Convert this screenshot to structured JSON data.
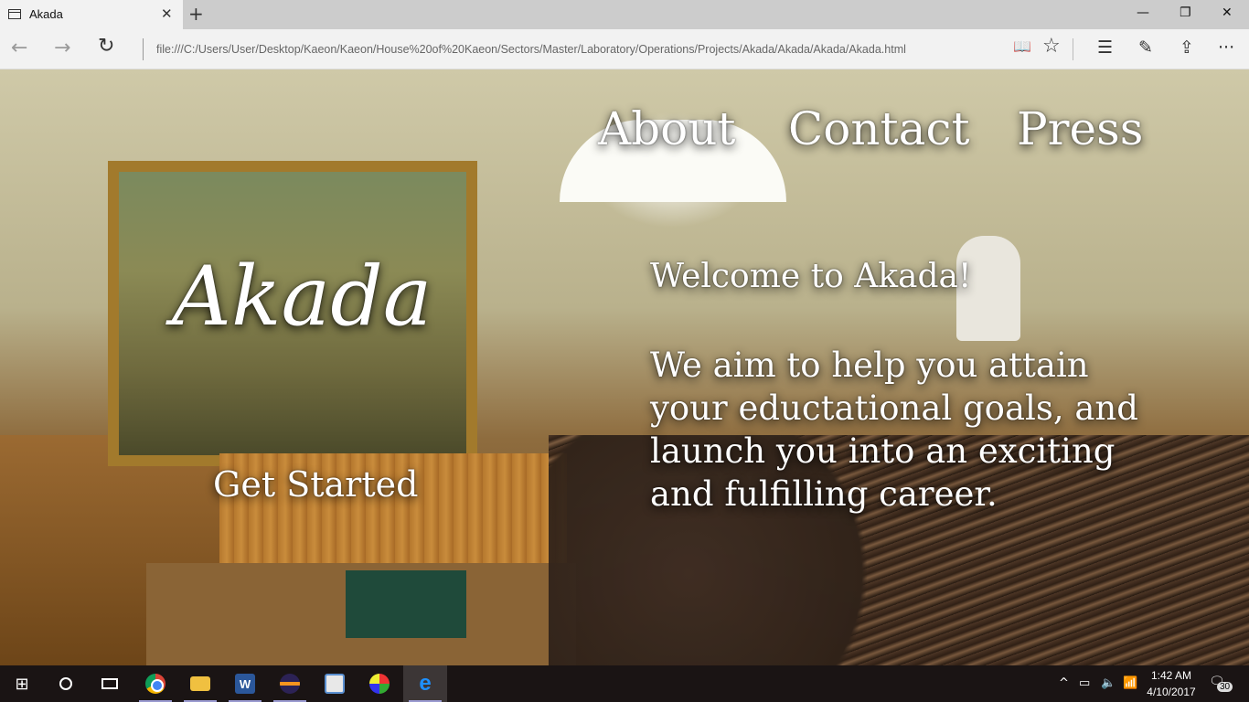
{
  "browser": {
    "tab_title": "Akada",
    "tab_close": "✕",
    "new_tab": "+",
    "window_controls": {
      "minimize": "—",
      "restore": "❐",
      "close": "✕"
    },
    "nav": {
      "back": "←",
      "forward": "→",
      "refresh": "↻"
    },
    "url": "file:///C:/Users/User/Desktop/Kaeon/Kaeon/House%20of%20Kaeon/Sectors/Master/Laboratory/Operations/Projects/Akada/Akada/Akada/Akada.html",
    "toolbar_icons": [
      "reading-view-icon",
      "favorite-star-icon",
      "hub-icon",
      "web-note-icon",
      "share-icon",
      "more-icon"
    ],
    "toolbar_glyphs": {
      "reading": "📖",
      "favorite": "☆",
      "hub": "☰",
      "note": "✎",
      "share": "⇪",
      "more": "···"
    }
  },
  "site": {
    "nav_links": [
      "About",
      "Contact",
      "Press"
    ],
    "brand": "Akada",
    "cta": "Get Started",
    "welcome": "Welcome to Akada!",
    "blurb": "We aim to help you attain your eductational goals, and launch you into an exciting and fulfilling career.",
    "background": "lecture-hall-photo"
  },
  "taskbar": {
    "start_glyph": "⊞",
    "apps": [
      "chrome",
      "file-explorer",
      "word",
      "eclipse",
      "photos",
      "paint",
      "edge"
    ],
    "tray": {
      "chevron": "^",
      "battery": "▭",
      "volume": "🔈",
      "wifi": "📶"
    },
    "time": "1:42 AM",
    "date": "4/10/2017",
    "notification_glyph": "🗨",
    "notification_count": "30"
  }
}
